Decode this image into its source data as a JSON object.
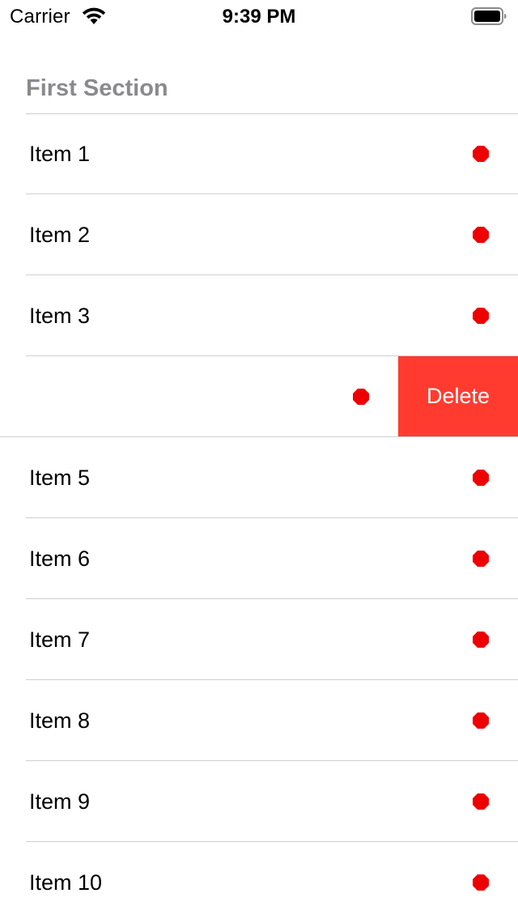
{
  "status_bar": {
    "carrier": "Carrier",
    "time": "9:39 PM",
    "wifi_icon": "wifi-icon",
    "battery_icon": "battery-icon"
  },
  "section": {
    "title": "First Section"
  },
  "items": [
    {
      "label": "Item 1"
    },
    {
      "label": "Item 2"
    },
    {
      "label": "Item 3"
    },
    {
      "label": ""
    },
    {
      "label": "Item 5"
    },
    {
      "label": "Item 6"
    },
    {
      "label": "Item 7"
    },
    {
      "label": "Item 8"
    },
    {
      "label": "Item 9"
    },
    {
      "label": "Item 10"
    }
  ],
  "swiped_row": {
    "delete_label": "Delete"
  },
  "colors": {
    "diamond": "#ee0000",
    "delete": "#ff3b30",
    "header_text": "#8a8a8e",
    "separator": "#cfcfd3"
  },
  "icons": {
    "row_accessory": "red-diamond-icon"
  }
}
